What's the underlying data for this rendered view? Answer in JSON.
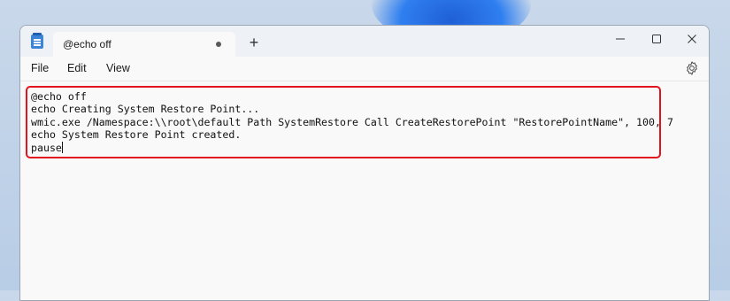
{
  "window": {
    "tab_title": "@echo off",
    "new_tab_symbol": "+",
    "controls": {
      "minimize": "minimize-icon",
      "maximize": "maximize-icon",
      "close": "close-icon"
    }
  },
  "menu": {
    "file": "File",
    "edit": "Edit",
    "view": "View",
    "settings_icon": "gear-icon"
  },
  "editor": {
    "lines": [
      "@echo off",
      "echo Creating System Restore Point...",
      "wmic.exe /Namespace:\\\\root\\default Path SystemRestore Call CreateRestorePoint \"RestorePointName\", 100, 7",
      "echo System Restore Point created.",
      "pause"
    ]
  },
  "colors": {
    "highlight_border": "#e0131f",
    "app_icon": "#3b84d8",
    "background_bloom": "#1f5fd6"
  }
}
